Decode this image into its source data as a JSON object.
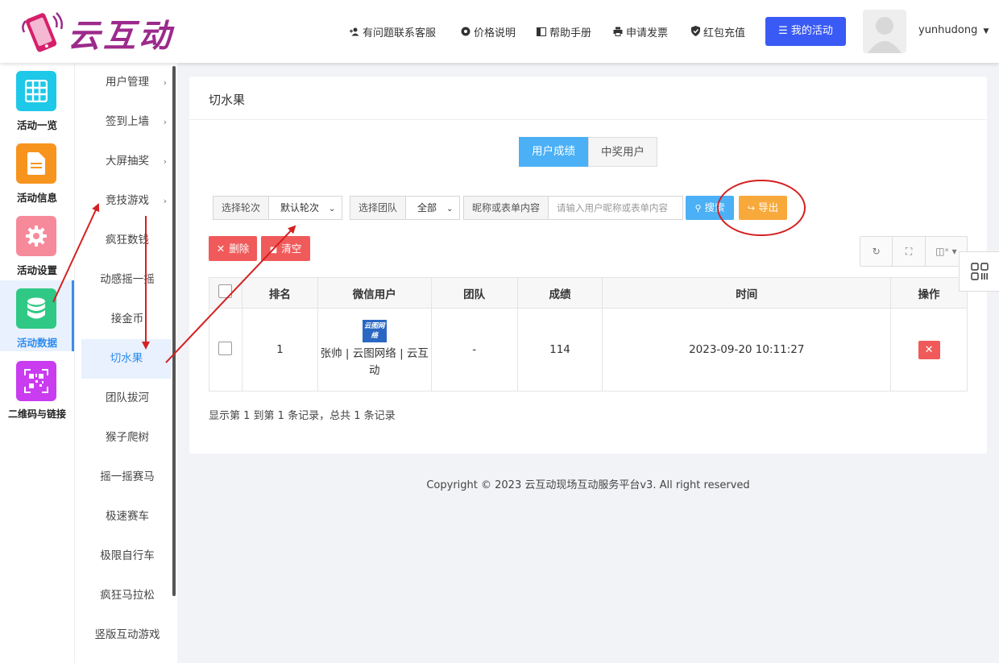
{
  "header": {
    "logo_text": "云互动",
    "links": [
      {
        "label": "有问题联系客服",
        "icon": "add-user-icon"
      },
      {
        "label": "价格说明",
        "icon": "gear-icon"
      },
      {
        "label": "帮助手册",
        "icon": "book-icon"
      },
      {
        "label": "申请发票",
        "icon": "printer-icon"
      },
      {
        "label": "红包充值",
        "icon": "shield-check-icon"
      }
    ],
    "my_activity_label": "我的活动",
    "username": "yunhudong",
    "accent_color": "#3a5af5"
  },
  "left_nav": {
    "items": [
      {
        "label": "活动一览",
        "icon": "grid-icon",
        "color": "#1ec8e8"
      },
      {
        "label": "活动信息",
        "icon": "document-icon",
        "color": "#f7941d"
      },
      {
        "label": "活动设置",
        "icon": "gear-icon",
        "color": "#f68a9a"
      },
      {
        "label": "活动数据",
        "icon": "database-icon",
        "color": "#2fc985"
      },
      {
        "label": "二维码与链接",
        "icon": "qrcode-icon",
        "color": "#c93cf0"
      }
    ],
    "active_index": 3
  },
  "sub_nav": {
    "groups": [
      {
        "label": "用户管理"
      },
      {
        "label": "签到上墙"
      },
      {
        "label": "大屏抽奖"
      },
      {
        "label": "竞技游戏"
      }
    ],
    "games": [
      "疯狂数钱",
      "动感摇一摇",
      "接金币",
      "切水果",
      "团队拔河",
      "猴子爬树",
      "摇一摇赛马",
      "极速赛车",
      "极限自行车",
      "疯狂马拉松",
      "竖版互动游戏"
    ],
    "active_game": "切水果"
  },
  "main": {
    "title": "切水果",
    "tabs": [
      "用户成绩",
      "中奖用户"
    ],
    "active_tab": 0,
    "filters": {
      "round_label": "选择轮次",
      "round_value": "默认轮次",
      "team_label": "选择团队",
      "team_value": "全部",
      "keyword_label": "昵称或表单内容",
      "keyword_placeholder": "请输入用户昵称或表单内容"
    },
    "search_label": "搜索",
    "export_label": "导出",
    "delete_label": "删除",
    "clear_label": "清空",
    "columns": [
      "排名",
      "微信用户",
      "团队",
      "成绩",
      "时间",
      "操作"
    ],
    "rows": [
      {
        "rank": "1",
        "avatar_text": "云图网络",
        "user": "张帅 | 云图网络 | 云互动",
        "team": "-",
        "score": "114",
        "time": "2023-09-20 10:11:27"
      }
    ],
    "pagination_info": "显示第 1 到第 1 条记录，总共 1 条记录"
  },
  "footer": {
    "copyright": "Copyright © 2023 云互动现场互动服务平台v3. All right reserved"
  },
  "annotation_color": "#d42020"
}
